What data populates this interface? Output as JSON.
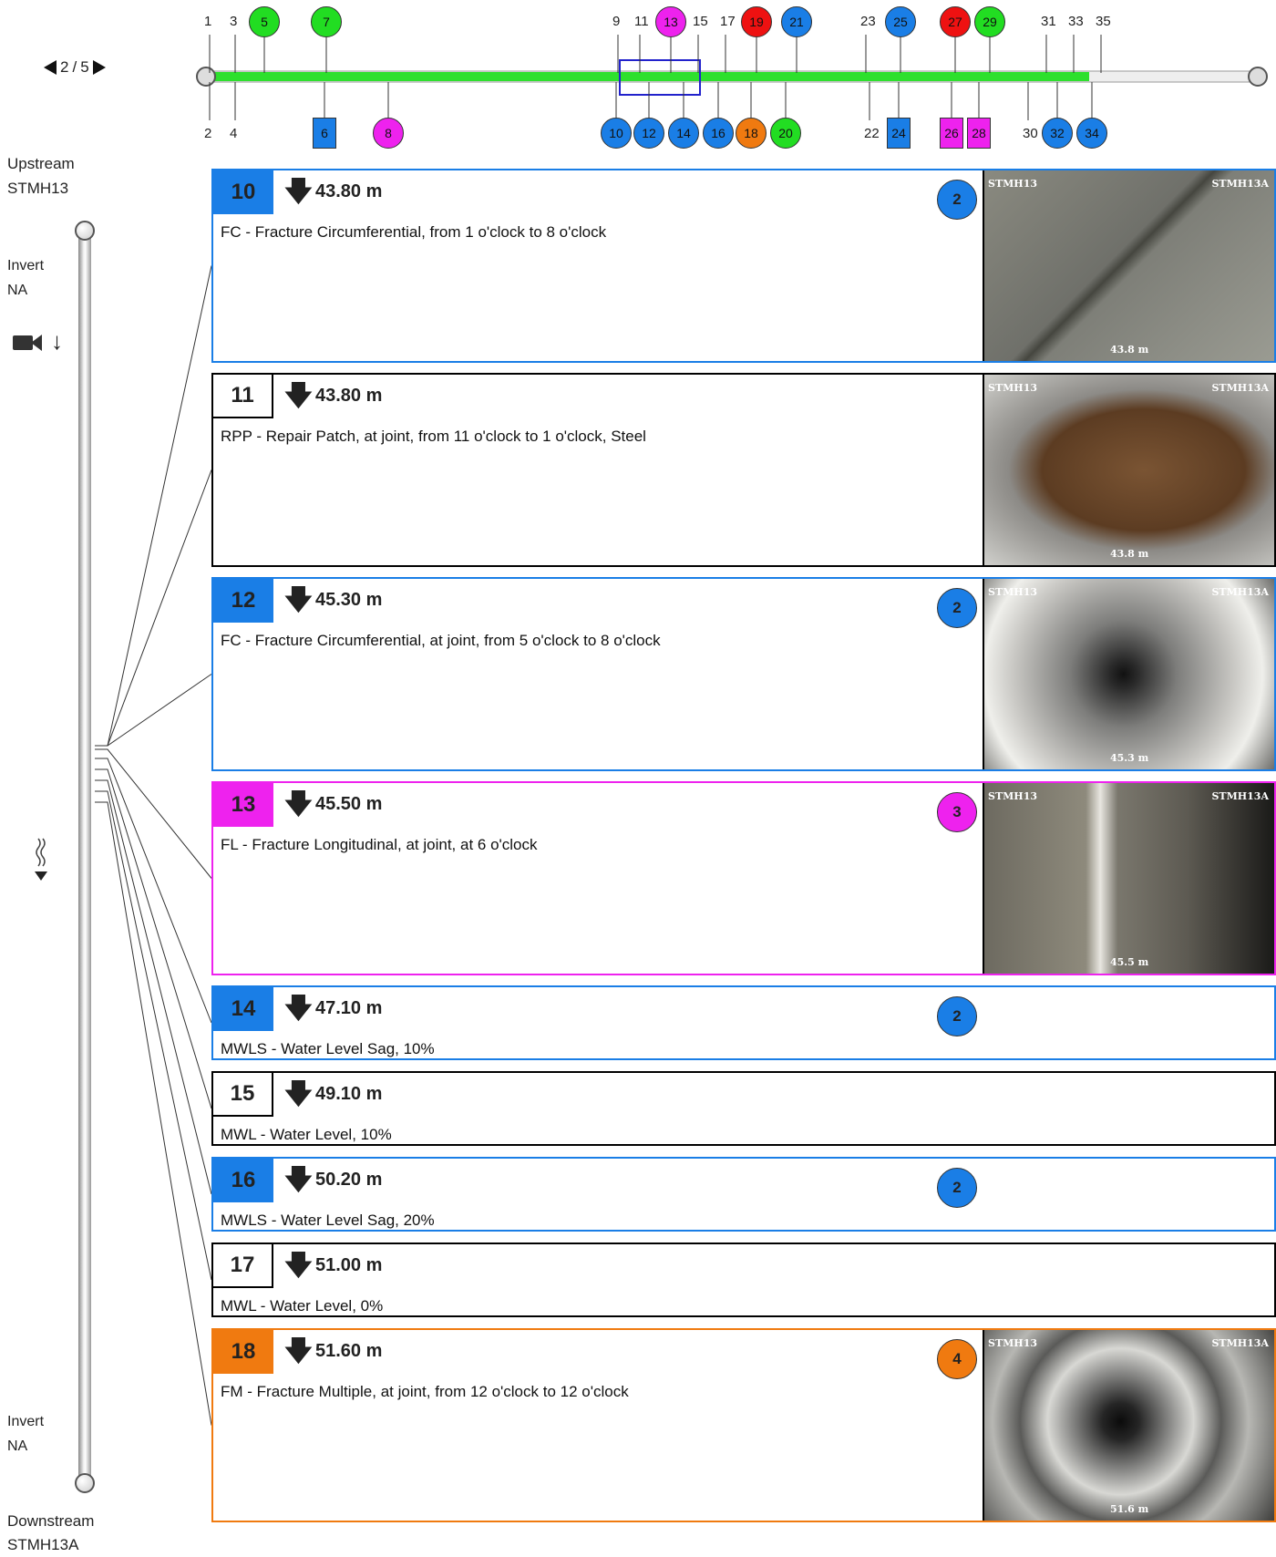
{
  "pager": {
    "current": "2",
    "separator": "/",
    "total": "5"
  },
  "colors": {
    "blue": "#1a7ee6",
    "green": "#22dd22",
    "magenta": "#ee22ee",
    "red": "#ee1111",
    "orange": "#f07a10",
    "pipe_fill": "#2ee02e"
  },
  "timeline": {
    "top_numbers": [
      "1",
      "3",
      "9",
      "11",
      "15",
      "17",
      "23",
      "31",
      "33",
      "35"
    ],
    "bottom_numbers": [
      "2",
      "4",
      "22",
      "30"
    ],
    "top_markers": [
      {
        "label": "5",
        "color": "green"
      },
      {
        "label": "7",
        "color": "green"
      },
      {
        "label": "13",
        "color": "magenta"
      },
      {
        "label": "19",
        "color": "red"
      },
      {
        "label": "21",
        "color": "blue"
      },
      {
        "label": "25",
        "color": "blue"
      },
      {
        "label": "27",
        "color": "red"
      },
      {
        "label": "29",
        "color": "green"
      }
    ],
    "bottom_markers": [
      {
        "label": "6",
        "color": "blue",
        "shape": "square"
      },
      {
        "label": "8",
        "color": "magenta",
        "shape": "circle"
      },
      {
        "label": "10",
        "color": "blue",
        "shape": "circle"
      },
      {
        "label": "12",
        "color": "blue",
        "shape": "circle"
      },
      {
        "label": "14",
        "color": "blue",
        "shape": "circle"
      },
      {
        "label": "16",
        "color": "blue",
        "shape": "circle"
      },
      {
        "label": "18",
        "color": "orange",
        "shape": "circle"
      },
      {
        "label": "20",
        "color": "green",
        "shape": "circle"
      },
      {
        "label": "24",
        "color": "blue",
        "shape": "square"
      },
      {
        "label": "26",
        "color": "magenta",
        "shape": "square"
      },
      {
        "label": "28",
        "color": "magenta",
        "shape": "square"
      },
      {
        "label": "32",
        "color": "blue",
        "shape": "circle"
      },
      {
        "label": "34",
        "color": "blue",
        "shape": "circle"
      }
    ],
    "progress_fraction": 0.84
  },
  "side": {
    "upstream_label": "Upstream",
    "upstream_id": "STMH13",
    "invert_top_label": "Invert",
    "invert_top_value": "NA",
    "invert_bottom_label": "Invert",
    "invert_bottom_value": "NA",
    "downstream_label": "Downstream",
    "downstream_id": "STMH13A",
    "icons": [
      "camera-icon",
      "direction-down-icon",
      "flow-icon"
    ]
  },
  "observations": [
    {
      "num": "10",
      "color": "blue",
      "distance": "43.80 m",
      "desc": "FC - Fracture Circumferential, from 1 o'clock to 8 o'clock",
      "grade": "2",
      "photo": {
        "left": "STMH13",
        "right": "STMH13A",
        "dist": "43.8 m"
      }
    },
    {
      "num": "11",
      "color": "none",
      "distance": "43.80 m",
      "desc": "RPP - Repair Patch, at joint, from 11 o'clock to 1 o'clock, Steel",
      "grade": "",
      "photo": {
        "left": "STMH13",
        "right": "STMH13A",
        "dist": "43.8 m"
      }
    },
    {
      "num": "12",
      "color": "blue",
      "distance": "45.30 m",
      "desc": "FC - Fracture Circumferential, at joint, from 5 o'clock to 8 o'clock",
      "grade": "2",
      "photo": {
        "left": "STMH13",
        "right": "STMH13A",
        "dist": "45.3 m"
      }
    },
    {
      "num": "13",
      "color": "magenta",
      "distance": "45.50 m",
      "desc": "FL - Fracture Longitudinal, at joint, at 6 o'clock",
      "grade": "3",
      "photo": {
        "left": "STMH13",
        "right": "STMH13A",
        "dist": "45.5 m"
      }
    },
    {
      "num": "14",
      "color": "blue",
      "distance": "47.10 m",
      "desc": "MWLS - Water Level Sag, 10%",
      "grade": "2"
    },
    {
      "num": "15",
      "color": "none",
      "distance": "49.10 m",
      "desc": "MWL - Water Level, 10%",
      "grade": ""
    },
    {
      "num": "16",
      "color": "blue",
      "distance": "50.20 m",
      "desc": "MWLS - Water Level Sag, 20%",
      "grade": "2"
    },
    {
      "num": "17",
      "color": "none",
      "distance": "51.00 m",
      "desc": "MWL - Water Level, 0%",
      "grade": ""
    },
    {
      "num": "18",
      "color": "orange",
      "distance": "51.60 m",
      "desc": "FM - Fracture Multiple, at joint, from 12 o'clock to 12 o'clock",
      "grade": "4",
      "photo": {
        "left": "STMH13",
        "right": "STMH13A",
        "dist": "51.6 m"
      }
    }
  ]
}
